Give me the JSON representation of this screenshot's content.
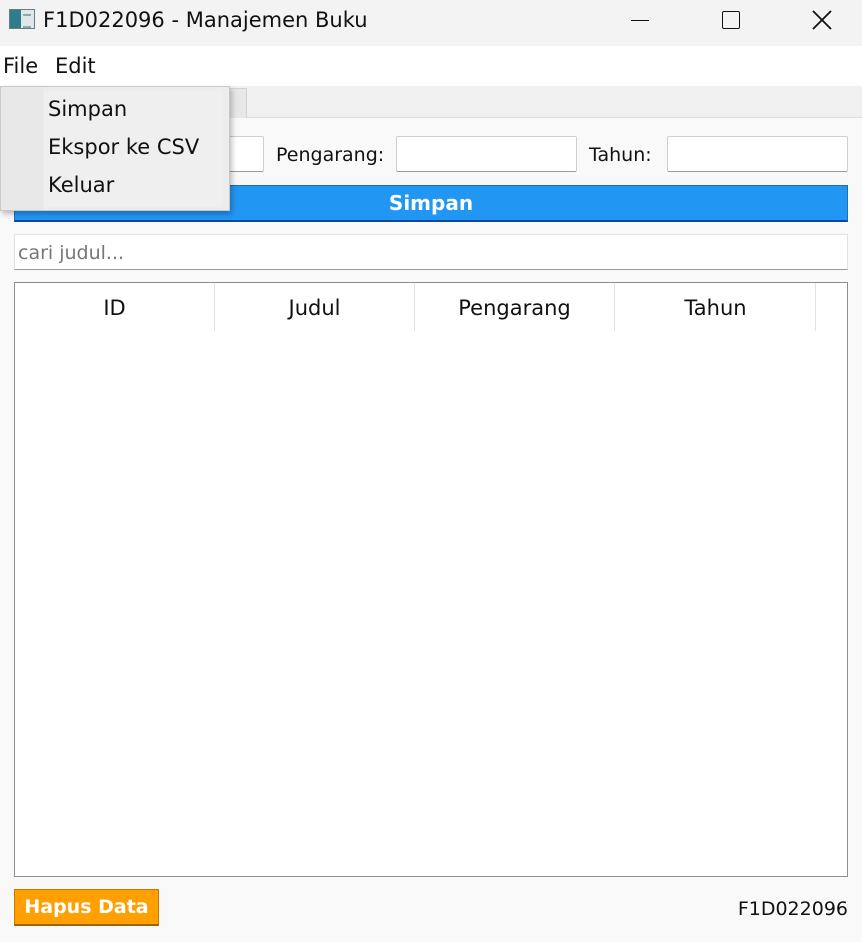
{
  "window": {
    "title": "F1D022096 - Manajemen Buku",
    "icon": "app-table-icon"
  },
  "menubar": {
    "file": "File",
    "edit": "Edit"
  },
  "file_menu": {
    "items": [
      "Simpan",
      "Ekspor ke CSV",
      "Keluar"
    ]
  },
  "form": {
    "pengarang_label": "Pengarang:",
    "tahun_label": "Tahun:",
    "judul_value": "",
    "pengarang_value": "",
    "tahun_value": "",
    "save_label": "Simpan",
    "save_color": "#2196f3"
  },
  "search": {
    "placeholder": "cari judul..."
  },
  "table": {
    "columns": [
      "ID",
      "Judul",
      "Pengarang",
      "Tahun"
    ],
    "rows": []
  },
  "footer": {
    "delete_label": "Hapus Data",
    "delete_color": "#ffa000",
    "status": "F1D022096"
  }
}
